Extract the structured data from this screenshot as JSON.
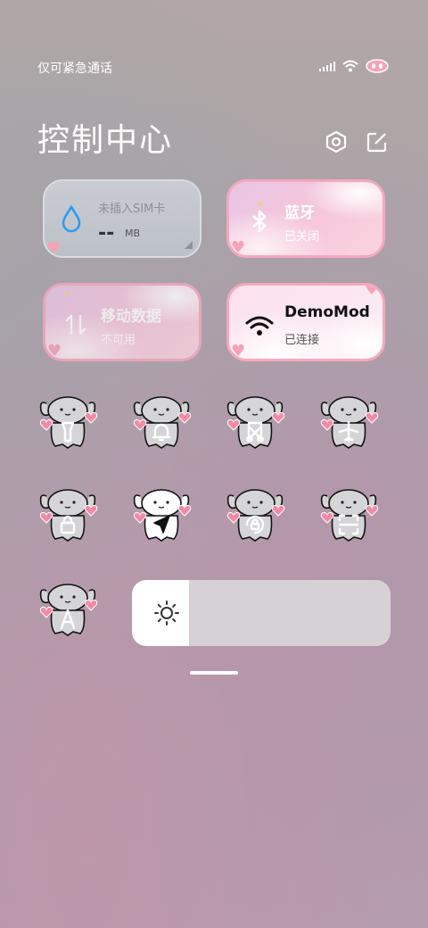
{
  "status_bar": {
    "carrier_text": "仅可紧急通话",
    "signal_bars": 4,
    "wifi_icon": "wifi-icon",
    "battery_icon": "pig-nose-battery-icon"
  },
  "header": {
    "title": "控制中心",
    "settings_icon": "hexagon-settings-icon",
    "edit_icon": "edit-icon"
  },
  "tiles": {
    "data_usage": {
      "label": "未插入SIM卡",
      "value": "--",
      "unit": "MB",
      "icon": "water-drop-icon"
    },
    "bluetooth": {
      "title": "蓝牙",
      "status": "已关闭",
      "icon": "bluetooth-icon"
    },
    "mobile_data": {
      "title": "移动数据",
      "status": "不可用",
      "icon": "mobile-data-icon"
    },
    "wifi": {
      "title": "DemoMod",
      "status": "已连接",
      "icon": "wifi-icon"
    }
  },
  "toggles": [
    {
      "name": "flashlight",
      "icon": "flashlight-icon",
      "active": false
    },
    {
      "name": "ring",
      "icon": "bell-icon",
      "active": false
    },
    {
      "name": "screenshot",
      "icon": "scissors-icon",
      "active": false
    },
    {
      "name": "airplane-mode",
      "icon": "airplane-icon",
      "active": false
    },
    {
      "name": "lock-screen",
      "icon": "lock-icon",
      "active": false
    },
    {
      "name": "location",
      "icon": "location-arrow-icon",
      "active": true
    },
    {
      "name": "rotation-lock",
      "icon": "rotation-lock-icon",
      "active": false
    },
    {
      "name": "scanner",
      "icon": "scan-icon",
      "active": false
    },
    {
      "name": "auto-brightness",
      "icon": "letter-a-icon",
      "active": false
    }
  ],
  "brightness": {
    "level": 0.22,
    "icon": "sun-icon"
  },
  "colors": {
    "accent_pink": "#f5a8bd",
    "heart_pink": "#f28aa6",
    "drop_blue": "#2f9bef",
    "active_icon": "#111111"
  }
}
